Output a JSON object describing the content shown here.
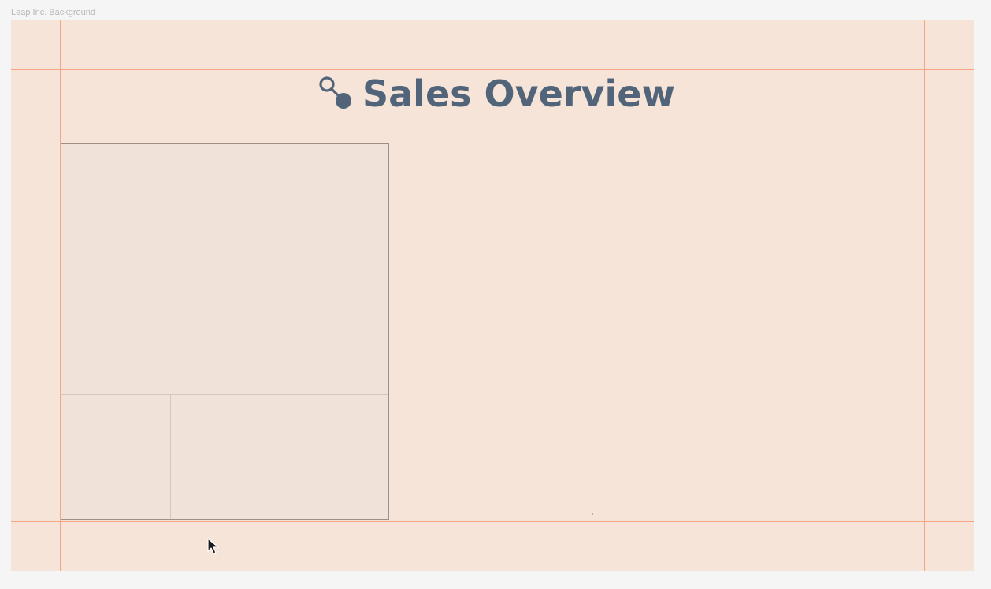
{
  "canvas": {
    "frame_label": "Leap Inc. Background"
  },
  "header": {
    "title": "Sales Overview",
    "logo_icon": "key-node-icon"
  },
  "colors": {
    "canvas_background": "#f5e4d7",
    "guide_line": "#f6a585",
    "title_text": "#526479",
    "panel_border": "#9d8f86",
    "panel_background": "#f0e2d9"
  },
  "cursor": {
    "icon": "arrow-cursor-icon"
  }
}
